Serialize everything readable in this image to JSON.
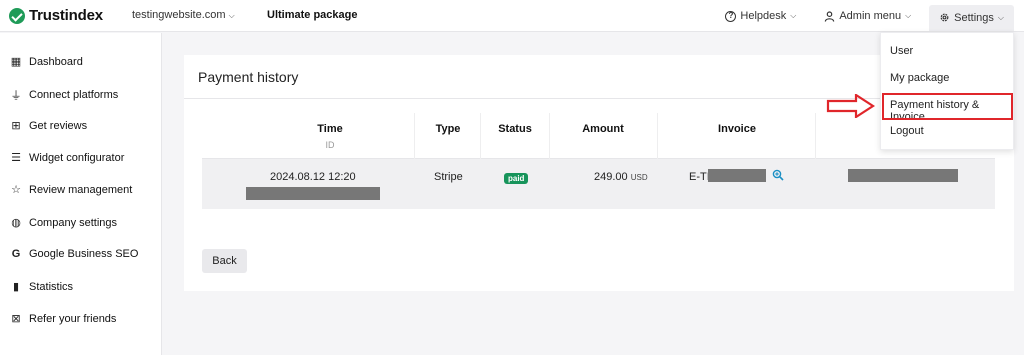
{
  "header": {
    "brand": "Trustindex",
    "site_select": "testingwebsite.com",
    "package": "Ultimate package",
    "helpdesk": "Helpdesk",
    "admin_menu": "Admin menu",
    "settings": "Settings"
  },
  "sidebar": {
    "items": [
      {
        "label": "Dashboard",
        "icon": "grid-icon"
      },
      {
        "label": "Connect platforms",
        "icon": "plug-icon"
      },
      {
        "label": "Get reviews",
        "icon": "message-plus-icon"
      },
      {
        "label": "Widget configurator",
        "icon": "sliders-icon"
      },
      {
        "label": "Review management",
        "icon": "star-icon"
      },
      {
        "label": "Company settings",
        "icon": "globe-icon"
      },
      {
        "label": "Google Business SEO",
        "icon": "google-icon"
      },
      {
        "label": "Statistics",
        "icon": "bar-chart-icon"
      },
      {
        "label": "Refer your friends",
        "icon": "gift-icon"
      }
    ]
  },
  "main": {
    "title": "Payment history",
    "table": {
      "columns": [
        "Time",
        "Type",
        "Status",
        "Amount",
        "Invoice"
      ],
      "time_sub": "ID",
      "rows": [
        {
          "time": "2024.08.12 12:20",
          "type": "Stripe",
          "status": "paid",
          "amount": "249.00",
          "currency": "USD",
          "invoice_prefix": "E-TI"
        }
      ]
    },
    "back_label": "Back"
  },
  "settings_menu": {
    "items": [
      "User",
      "My package",
      "Payment history & Invoice",
      "Logout"
    ]
  },
  "colors": {
    "brand": "#1f9b58",
    "paid_badge": "#17945b",
    "highlight": "#e0262b",
    "redacted": "#777777"
  }
}
